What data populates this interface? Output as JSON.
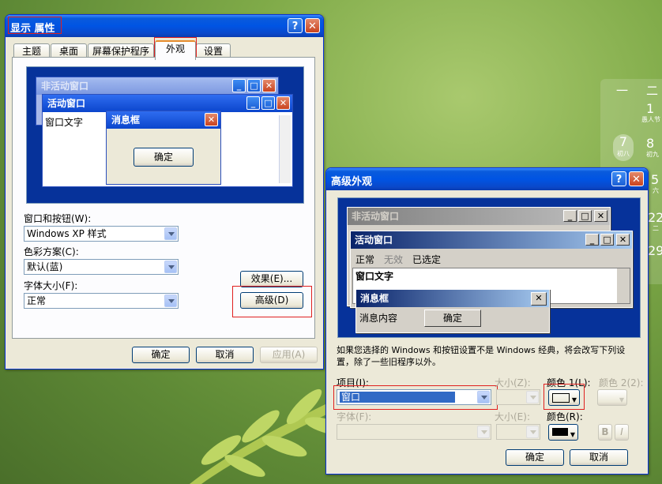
{
  "display_props": {
    "title": "显示 属性",
    "tabs": [
      "主题",
      "桌面",
      "屏幕保护程序",
      "外观",
      "设置"
    ],
    "active_tab": "外观",
    "preview": {
      "inactive_title": "非活动窗口",
      "active_title": "活动窗口",
      "window_text": "窗口文字",
      "message_title": "消息框",
      "ok_label": "确定"
    },
    "windows_buttons_label": "窗口和按钮(W):",
    "windows_buttons_value": "Windows XP 样式",
    "color_scheme_label": "色彩方案(C):",
    "color_scheme_value": "默认(蓝)",
    "font_size_label": "字体大小(F):",
    "font_size_value": "正常",
    "effects_button": "效果(E)...",
    "advanced_button": "高级(D)",
    "ok_button": "确定",
    "cancel_button": "取消",
    "apply_button": "应用(A)"
  },
  "advanced": {
    "title": "高级外观",
    "preview": {
      "inactive_title": "非活动窗口",
      "active_title": "活动窗口",
      "menu_normal": "正常",
      "menu_disabled": "无效",
      "menu_selected": "已选定",
      "window_text": "窗口文字",
      "message_title": "消息框",
      "message_text": "消息内容",
      "ok_label": "确定"
    },
    "notice": "如果您选择的 Windows 和按钮设置不是 Windows 经典，将会改写下列设置，除了一些旧程序以外。",
    "item_label": "项目(I):",
    "item_value": "窗口",
    "size_label": "大小(Z):",
    "color1_label": "颜色 1(L):",
    "color2_label": "颜色 2(2):",
    "font_label": "字体(F):",
    "size2_label": "大小(E):",
    "color_label": "颜色(R):",
    "bold_label": "B",
    "italic_label": "I",
    "ok_button": "确定",
    "cancel_button": "取消",
    "color1_value": "#ffffff",
    "font_color_value": "#000000"
  },
  "calendar": {
    "weekdays": [
      "一",
      "二"
    ],
    "days": [
      {
        "num": "1",
        "sub": "愚人节"
      },
      {
        "num": "7",
        "sub": "初八"
      },
      {
        "num": "8",
        "sub": "初九"
      },
      {
        "num": "5",
        "sub": "六"
      },
      {
        "num": "22",
        "sub": "二"
      },
      {
        "num": "29",
        "sub": ""
      }
    ]
  },
  "colors": {
    "xp_title_blue": "#0054e3",
    "dialog_bg": "#ece9d8",
    "highlight_red": "#e0201f",
    "selection_blue": "#316ac5"
  }
}
